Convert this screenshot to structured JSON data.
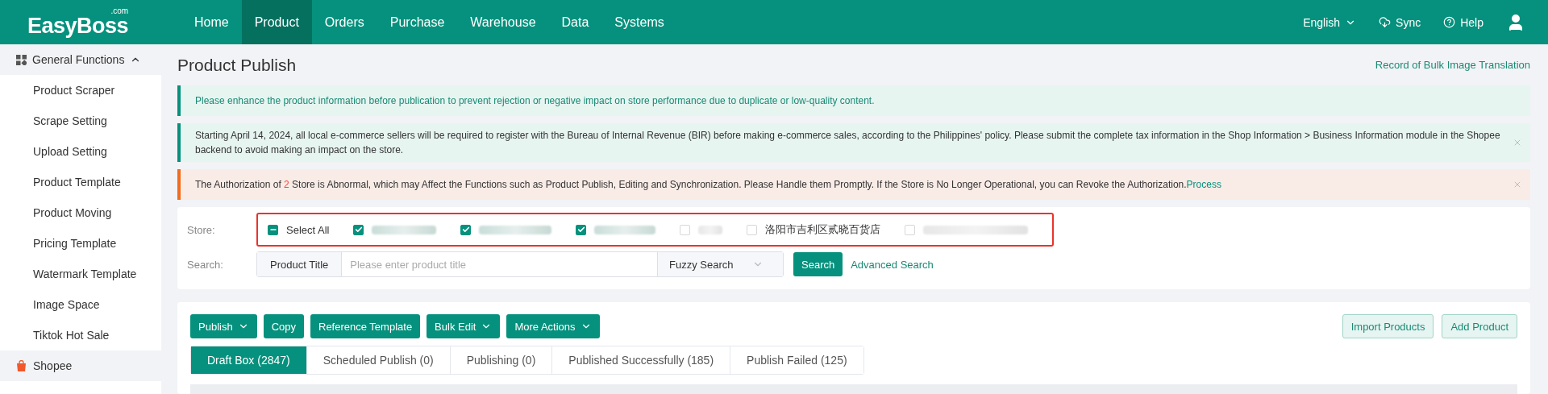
{
  "header": {
    "logo": "EasyBoss",
    "logo_suffix": ".com",
    "nav": [
      {
        "label": "Home",
        "selected": false
      },
      {
        "label": "Product",
        "selected": true
      },
      {
        "label": "Orders",
        "selected": false
      },
      {
        "label": "Purchase",
        "selected": false
      },
      {
        "label": "Warehouse",
        "selected": false
      },
      {
        "label": "Data",
        "selected": false
      },
      {
        "label": "Systems",
        "selected": false
      }
    ],
    "language": "English",
    "sync": "Sync",
    "help": "Help"
  },
  "sidebar": {
    "group": {
      "label": "General Functions",
      "expanded": true
    },
    "items": [
      {
        "label": "Product Scraper"
      },
      {
        "label": "Scrape Setting"
      },
      {
        "label": "Upload Setting"
      },
      {
        "label": "Product Template"
      },
      {
        "label": "Product Moving"
      },
      {
        "label": "Pricing Template"
      },
      {
        "label": "Watermark Template"
      },
      {
        "label": "Image Space"
      },
      {
        "label": "Tiktok Hot Sale"
      }
    ],
    "platform": {
      "label": "Shopee",
      "selected": true
    }
  },
  "page": {
    "title": "Product Publish",
    "link": "Record of Bulk Image Translation"
  },
  "alerts": [
    {
      "kind": "info",
      "text": "Please enhance the product information before publication to prevent rejection or negative impact on store performance due to duplicate or low-quality content.",
      "closable": false
    },
    {
      "kind": "info",
      "text": "Starting April 14, 2024, all local e-commerce sellers will be required to register with the Bureau of Internal Revenue (BIR) before making e-commerce sales, according to the Philippines' policy. Please submit the complete tax information in the Shop Information > Business Information module in the Shopee backend to avoid making an impact on the store.",
      "closable": true
    },
    {
      "kind": "warning",
      "text_before": "The Authorization of ",
      "count": "2",
      "text_after": " Store is Abnormal, which may Affect the Functions such as Product Publish, Editing and Synchronization. Please Handle them Promptly. If the Store is No Longer Operational, you can Revoke the Authorization.",
      "action": "Process",
      "closable": true
    }
  ],
  "filter": {
    "store_label": "Store:",
    "select_all": {
      "label": "Select All",
      "checked": true,
      "indeterminate": true
    },
    "stores": [
      {
        "kind": "blurred",
        "checked": true
      },
      {
        "kind": "blurred",
        "checked": true
      },
      {
        "kind": "blurred",
        "checked": true
      },
      {
        "kind": "blurred",
        "checked": false
      },
      {
        "kind": "named",
        "name": "洛阳市吉利区贰晓百货店",
        "checked": false
      },
      {
        "kind": "blurred",
        "checked": false
      }
    ],
    "search_label": "Search:",
    "field_type": "Product Title",
    "placeholder": "Please enter product title",
    "mode": "Fuzzy Search",
    "search_button": "Search",
    "advanced": "Advanced Search"
  },
  "actions": [
    {
      "label": "Publish",
      "dropdown": true
    },
    {
      "label": "Copy",
      "dropdown": false
    },
    {
      "label": "Reference Template",
      "dropdown": false
    },
    {
      "label": "Bulk Edit",
      "dropdown": true
    },
    {
      "label": "More Actions",
      "dropdown": true
    }
  ],
  "right_actions": [
    "Import Products",
    "Add Product"
  ],
  "tabs": [
    {
      "label": "Draft Box (2847)",
      "selected": true
    },
    {
      "label": "Scheduled Publish (0)",
      "selected": false
    },
    {
      "label": "Publishing (0)",
      "selected": false
    },
    {
      "label": "Published Successfully (185)",
      "selected": false
    },
    {
      "label": "Publish Failed (125)",
      "selected": false
    }
  ]
}
